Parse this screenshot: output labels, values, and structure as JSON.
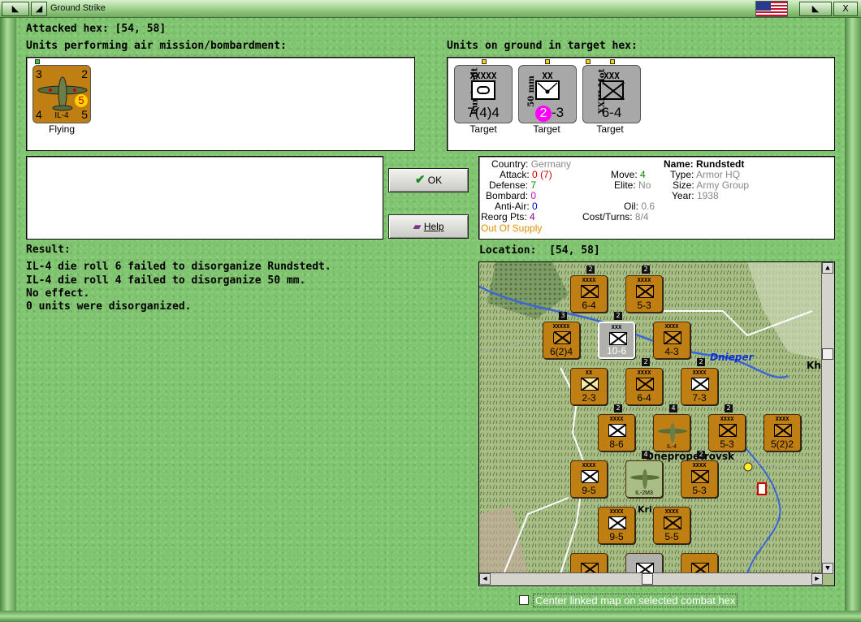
{
  "window": {
    "title": "Ground Strike",
    "close_glyph": "X"
  },
  "attacked_hex": {
    "label": "Attacked hex:",
    "coords": "[54, 58]"
  },
  "air_units": {
    "heading": "Units performing air mission/bombardment:",
    "units": [
      {
        "name": "IL-4",
        "top_left": "3",
        "top_right": "2",
        "bottom_left": "4",
        "bottom_right": "5",
        "badge": "5",
        "status": "Flying"
      }
    ]
  },
  "ground_units": {
    "heading": "Units on ground in target hex:",
    "units": [
      {
        "name": "Rundstedt",
        "size": "XXXXX",
        "strength": "7(4)4",
        "status": "Target",
        "color": "#a8a8a8"
      },
      {
        "name": "50 mm",
        "size": "XX",
        "strength": "2-3",
        "disorg": "2",
        "status": "Target",
        "color": "#a8a8a8"
      },
      {
        "name": "XXIII Mot",
        "size": "XXX",
        "strength": "6-4",
        "status": "Target",
        "color": "#a8a8a8"
      }
    ]
  },
  "buttons": {
    "ok": "OK",
    "help": "Help"
  },
  "unit_info": {
    "country_label": "Country:",
    "country": "Germany",
    "attack_label": "Attack:",
    "attack": "0",
    "attack_mod": "(7)",
    "defense_label": "Defense:",
    "defense": "7",
    "bombard_label": "Bombard:",
    "bombard": "0",
    "antiair_label": "Anti-Air:",
    "antiair": "0",
    "reorg_label": "Reorg Pts:",
    "reorg": "4",
    "supply_status": "Out Of Supply",
    "move_label": "Move:",
    "move": "4",
    "elite_label": "Elite:",
    "elite": "No",
    "oil_label": "Oil:",
    "oil": "0.6",
    "cost_label": "Cost/Turns:",
    "cost": "8/4",
    "name_label": "Name:",
    "name": "Rundstedt",
    "type_label": "Type:",
    "type": "Armor HQ",
    "size_label": "Size:",
    "size": "Army Group",
    "year_label": "Year:",
    "year": "1938"
  },
  "result": {
    "heading": "Result:",
    "lines": [
      "IL-4 die roll 6 failed to disorganize Rundstedt.",
      "IL-4 die roll 4 failed to disorganize 50 mm.",
      "No effect.",
      "0 units were disorganized."
    ]
  },
  "location": {
    "label": "Location:",
    "coords": "[54, 58]",
    "river_label": "Dnieper",
    "city_label": "Dnepropetrovsk",
    "city2_label": "Kri",
    "edge_label": "Kh",
    "counters": [
      {
        "value": "6-4",
        "size": "XXXX",
        "stack": "2",
        "grey": false
      },
      {
        "value": "5-3",
        "size": "XXXX",
        "stack": "2",
        "grey": false
      },
      {
        "value": "6(2)4",
        "size": "XXXXX",
        "stack": "3",
        "grey": false
      },
      {
        "value": "10-6",
        "size": "XXX",
        "stack": "2",
        "grey": true
      },
      {
        "value": "4-3",
        "size": "XXXX",
        "stack": "",
        "grey": false
      },
      {
        "value": "2-3",
        "size": "XX",
        "stack": "",
        "grey": false
      },
      {
        "value": "6-4",
        "size": "XXXX",
        "stack": "2",
        "grey": false
      },
      {
        "value": "7-3",
        "size": "XXXX",
        "stack": "2",
        "grey": false
      },
      {
        "value": "8-6",
        "size": "XXXX",
        "stack": "2",
        "grey": false
      },
      {
        "value": "IL-4",
        "size": "",
        "stack": "4",
        "grey": false
      },
      {
        "value": "5-3",
        "size": "XXXX",
        "stack": "2",
        "grey": false
      },
      {
        "value": "5(2)2",
        "size": "XXXX",
        "stack": "",
        "grey": false
      },
      {
        "value": "9-5",
        "size": "XXXX",
        "stack": "",
        "grey": false
      },
      {
        "value": "IL-2M3",
        "size": "",
        "stack": "4",
        "grey": false
      },
      {
        "value": "5-3",
        "size": "XXXX",
        "stack": "2",
        "grey": false
      },
      {
        "value": "9-5",
        "size": "XXXX",
        "stack": "",
        "grey": false
      },
      {
        "value": "5-5",
        "size": "XXXX",
        "stack": "",
        "grey": false
      }
    ]
  },
  "footer": {
    "center_map_label": "Center linked map on selected combat hex",
    "center_map_checked": false
  },
  "colors": {
    "background": "#7fc46f",
    "unit_axis": "#c07f13",
    "attack": "#d00000",
    "defense": "#008a00",
    "bombard": "#d000d0",
    "antiair": "#0000cc",
    "reorg": "#8a008a",
    "supply": "#e09000",
    "muted": "#888888"
  }
}
